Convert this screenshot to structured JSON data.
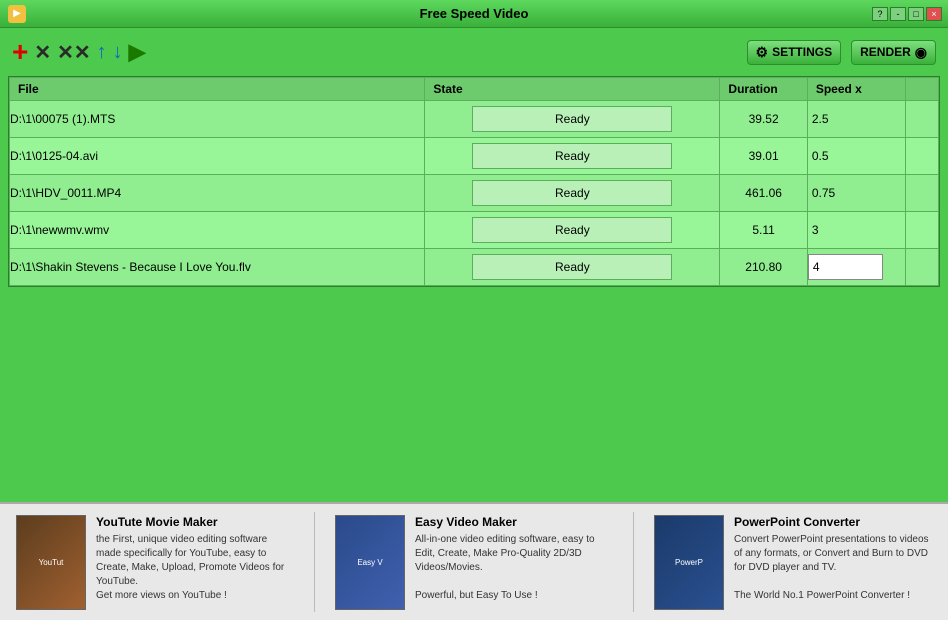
{
  "window": {
    "title": "Free Speed Video",
    "controls": [
      "?",
      "-",
      "□",
      "×"
    ]
  },
  "toolbar": {
    "settings_label": "SETTINGS",
    "render_label": "RENDER"
  },
  "table": {
    "headers": [
      "File",
      "State",
      "Duration",
      "Speed x"
    ],
    "rows": [
      {
        "file": "D:\\1\\00075 (1).MTS",
        "state": "Ready",
        "duration": "39.52",
        "speed": "2.5",
        "editable": false
      },
      {
        "file": "D:\\1\\0125-04.avi",
        "state": "Ready",
        "duration": "39.01",
        "speed": "0.5",
        "editable": false
      },
      {
        "file": "D:\\1\\HDV_0011.MP4",
        "state": "Ready",
        "duration": "461.06",
        "speed": "0.75",
        "editable": false
      },
      {
        "file": "D:\\1\\newwmv.wmv",
        "state": "Ready",
        "duration": "5.11",
        "speed": "3",
        "editable": false
      },
      {
        "file": "D:\\1\\Shakin Stevens - Because I Love You.flv",
        "state": "Ready",
        "duration": "210.80",
        "speed": "4",
        "editable": true
      }
    ]
  },
  "promos": [
    {
      "title": "YouTute Movie Maker",
      "desc": "the First, unique video editing software made specifically for YouTube, easy to Create, Make, Upload, Promote Videos for YouTube.\nGet more views on YouTube !",
      "thumb": "yt"
    },
    {
      "title": "Easy Video Maker",
      "desc": "All-in-one video editing software, easy to Edit, Create, Make Pro-Quality 2D/3D Videos/Movies.\n\nPowerful, but Easy To Use !",
      "thumb": "ev"
    },
    {
      "title": "PowerPoint Converter",
      "desc": "Convert PowerPoint presentations to videos of any formats, or Convert and Burn to DVD for DVD player and TV.\n\nThe World No.1 PowerPoint Converter !",
      "thumb": "pp"
    }
  ]
}
